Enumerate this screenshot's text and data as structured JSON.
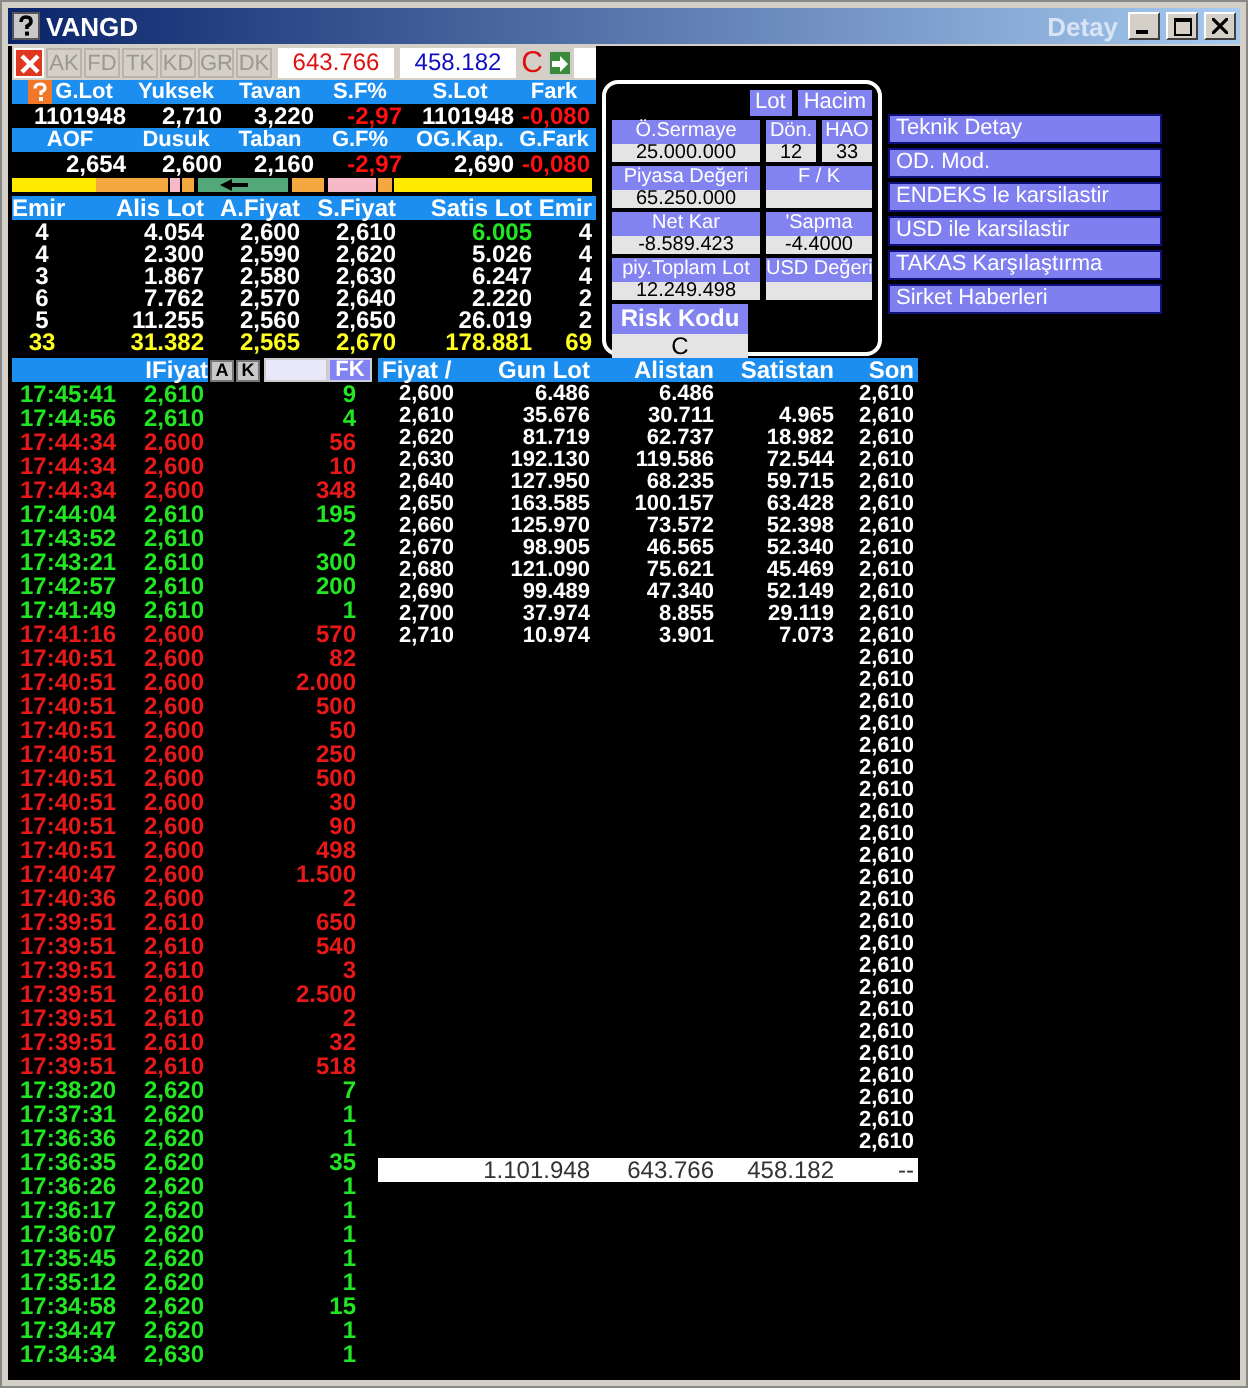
{
  "window": {
    "title": "VANGD",
    "right_title": "Detay"
  },
  "toolbar": {
    "tabs": [
      {
        "label": "AK",
        "disabled": true
      },
      {
        "label": "FD",
        "disabled": true
      },
      {
        "label": "TK",
        "disabled": true
      },
      {
        "label": "KD",
        "disabled": true
      },
      {
        "label": "GR",
        "disabled": true
      },
      {
        "label": "DK",
        "disabled": true
      }
    ],
    "buy_total": "643.766",
    "sell_total": "458.182",
    "risk": "C"
  },
  "quote": {
    "blocks": [
      {
        "headers": [
          "G.Lot",
          "Yuksek",
          "Tavan",
          "S.F%",
          "S.Lot",
          "Fark"
        ],
        "values": [
          {
            "text": "1101948",
            "kind": "plain"
          },
          {
            "text": "2,710",
            "kind": "plain"
          },
          {
            "text": "3,220",
            "kind": "plain"
          },
          {
            "text": "-2,97",
            "kind": "down"
          },
          {
            "text": "1101948",
            "kind": "plain"
          },
          {
            "text": "-0,080",
            "kind": "down"
          }
        ]
      },
      {
        "headers": [
          "AOF",
          "Dusuk",
          "Taban",
          "G.F%",
          "OG.Kap.",
          "G.Fark"
        ],
        "values": [
          {
            "text": "2,654",
            "kind": "plain"
          },
          {
            "text": "2,600",
            "kind": "plain"
          },
          {
            "text": "2,160",
            "kind": "plain"
          },
          {
            "text": "-2,97",
            "kind": "down"
          },
          {
            "text": "2,690",
            "kind": "plain"
          },
          {
            "text": "-0,080",
            "kind": "down"
          }
        ]
      }
    ]
  },
  "depth": {
    "headers": [
      "Emir",
      "Alis Lot",
      "A.Fiyat",
      "S.Fiyat",
      "Satis Lot",
      "Emir"
    ],
    "rows": [
      {
        "cells": [
          "4",
          "4.054",
          "2,600",
          "2,610",
          "6.005",
          "4"
        ],
        "kind": "order",
        "highlight": true
      },
      {
        "cells": [
          "4",
          "2.300",
          "2,590",
          "2,620",
          "5.026",
          "4"
        ],
        "kind": "order",
        "highlight": false
      },
      {
        "cells": [
          "3",
          "1.867",
          "2,580",
          "2,630",
          "6.247",
          "4"
        ],
        "kind": "order",
        "highlight": false
      },
      {
        "cells": [
          "6",
          "7.762",
          "2,570",
          "2,640",
          "2.220",
          "2"
        ],
        "kind": "order",
        "highlight": false
      },
      {
        "cells": [
          "5",
          "11.255",
          "2,560",
          "2,650",
          "26.019",
          "2"
        ],
        "kind": "order",
        "highlight": false
      },
      {
        "cells": [
          "33",
          "31.382",
          "2,565",
          "2,670",
          "178.881",
          "69"
        ],
        "kind": "total",
        "highlight": false
      }
    ]
  },
  "stats": {
    "buttons": [
      "Lot",
      "Hacim"
    ],
    "rows": [
      [
        {
          "label": "Ö.Sermaye",
          "value": "25.000.000"
        },
        {
          "label": "Dön.",
          "value": "12"
        },
        {
          "label": "HAO",
          "value": "33"
        }
      ],
      [
        {
          "label": "Piyasa Değeri",
          "value": "65.250.000"
        },
        {
          "label": "F / K"
        }
      ],
      [
        {
          "label": "Net Kar",
          "value": "-8.589.423"
        },
        {
          "label": "'Sapma",
          "value": "-4.4000"
        }
      ],
      [
        {
          "label": "piy.Toplam Lot",
          "value": "12.249.498"
        },
        {
          "label": "USD Değeri"
        }
      ]
    ],
    "risk": {
      "label": "Risk Kodu",
      "value": "C"
    }
  },
  "menu": [
    "Teknik Detay",
    "OD. Mod.",
    "ENDEKS le karsilastir",
    "USD ile karsilastir",
    "TAKAS Karşılaştırma",
    "Sirket Haberleri"
  ],
  "trades": {
    "header": "IFiyat",
    "buttons": [
      "A",
      "K"
    ],
    "filter_button": "FK",
    "rows": [
      {
        "time": "17:45:41",
        "price": "2,610",
        "lot": "9",
        "kind": "up"
      },
      {
        "time": "17:44:56",
        "price": "2,610",
        "lot": "4",
        "kind": "up"
      },
      {
        "time": "17:44:34",
        "price": "2,600",
        "lot": "56",
        "kind": "down"
      },
      {
        "time": "17:44:34",
        "price": "2,600",
        "lot": "10",
        "kind": "down"
      },
      {
        "time": "17:44:34",
        "price": "2,600",
        "lot": "348",
        "kind": "down"
      },
      {
        "time": "17:44:04",
        "price": "2,610",
        "lot": "195",
        "kind": "up"
      },
      {
        "time": "17:43:52",
        "price": "2,610",
        "lot": "2",
        "kind": "up"
      },
      {
        "time": "17:43:21",
        "price": "2,610",
        "lot": "300",
        "kind": "up"
      },
      {
        "time": "17:42:57",
        "price": "2,610",
        "lot": "200",
        "kind": "up"
      },
      {
        "time": "17:41:49",
        "price": "2,610",
        "lot": "1",
        "kind": "up"
      },
      {
        "time": "17:41:16",
        "price": "2,600",
        "lot": "570",
        "kind": "down"
      },
      {
        "time": "17:40:51",
        "price": "2,600",
        "lot": "82",
        "kind": "down"
      },
      {
        "time": "17:40:51",
        "price": "2,600",
        "lot": "2.000",
        "kind": "down"
      },
      {
        "time": "17:40:51",
        "price": "2,600",
        "lot": "500",
        "kind": "down"
      },
      {
        "time": "17:40:51",
        "price": "2,600",
        "lot": "50",
        "kind": "down"
      },
      {
        "time": "17:40:51",
        "price": "2,600",
        "lot": "250",
        "kind": "down"
      },
      {
        "time": "17:40:51",
        "price": "2,600",
        "lot": "500",
        "kind": "down"
      },
      {
        "time": "17:40:51",
        "price": "2,600",
        "lot": "30",
        "kind": "down"
      },
      {
        "time": "17:40:51",
        "price": "2,600",
        "lot": "90",
        "kind": "down"
      },
      {
        "time": "17:40:51",
        "price": "2,600",
        "lot": "498",
        "kind": "down"
      },
      {
        "time": "17:40:47",
        "price": "2,600",
        "lot": "1.500",
        "kind": "down"
      },
      {
        "time": "17:40:36",
        "price": "2,600",
        "lot": "2",
        "kind": "down"
      },
      {
        "time": "17:39:51",
        "price": "2,610",
        "lot": "650",
        "kind": "down"
      },
      {
        "time": "17:39:51",
        "price": "2,610",
        "lot": "540",
        "kind": "down"
      },
      {
        "time": "17:39:51",
        "price": "2,610",
        "lot": "3",
        "kind": "down"
      },
      {
        "time": "17:39:51",
        "price": "2,610",
        "lot": "2.500",
        "kind": "down"
      },
      {
        "time": "17:39:51",
        "price": "2,610",
        "lot": "2",
        "kind": "down"
      },
      {
        "time": "17:39:51",
        "price": "2,610",
        "lot": "32",
        "kind": "down"
      },
      {
        "time": "17:39:51",
        "price": "2,610",
        "lot": "518",
        "kind": "down"
      },
      {
        "time": "17:38:20",
        "price": "2,620",
        "lot": "7",
        "kind": "up"
      },
      {
        "time": "17:37:31",
        "price": "2,620",
        "lot": "1",
        "kind": "up"
      },
      {
        "time": "17:36:36",
        "price": "2,620",
        "lot": "1",
        "kind": "up"
      },
      {
        "time": "17:36:35",
        "price": "2,620",
        "lot": "35",
        "kind": "up"
      },
      {
        "time": "17:36:26",
        "price": "2,620",
        "lot": "1",
        "kind": "up"
      },
      {
        "time": "17:36:17",
        "price": "2,620",
        "lot": "1",
        "kind": "up"
      },
      {
        "time": "17:36:07",
        "price": "2,620",
        "lot": "1",
        "kind": "up"
      },
      {
        "time": "17:35:45",
        "price": "2,620",
        "lot": "1",
        "kind": "up"
      },
      {
        "time": "17:35:12",
        "price": "2,620",
        "lot": "1",
        "kind": "up"
      },
      {
        "time": "17:34:58",
        "price": "2,620",
        "lot": "15",
        "kind": "up"
      },
      {
        "time": "17:34:47",
        "price": "2,620",
        "lot": "1",
        "kind": "up"
      },
      {
        "time": "17:34:34",
        "price": "2,630",
        "lot": "1",
        "kind": "up"
      }
    ]
  },
  "book": {
    "headers": [
      "Fiyat /",
      "Gun Lot",
      "Alistan",
      "Satistan",
      "Son"
    ],
    "rows": [
      {
        "price": "2,600",
        "gun_lot": "6.486",
        "alistan": "6.486",
        "son": "2,610"
      },
      {
        "price": "2,610",
        "gun_lot": "35.676",
        "alistan": "30.711",
        "satistan": "4.965",
        "son": "2,610"
      },
      {
        "price": "2,620",
        "gun_lot": "81.719",
        "alistan": "62.737",
        "satistan": "18.982",
        "son": "2,610"
      },
      {
        "price": "2,630",
        "gun_lot": "192.130",
        "alistan": "119.586",
        "satistan": "72.544",
        "son": "2,610"
      },
      {
        "price": "2,640",
        "gun_lot": "127.950",
        "alistan": "68.235",
        "satistan": "59.715",
        "son": "2,610"
      },
      {
        "price": "2,650",
        "gun_lot": "163.585",
        "alistan": "100.157",
        "satistan": "63.428",
        "son": "2,610"
      },
      {
        "price": "2,660",
        "gun_lot": "125.970",
        "alistan": "73.572",
        "satistan": "52.398",
        "son": "2,610"
      },
      {
        "price": "2,670",
        "gun_lot": "98.905",
        "alistan": "46.565",
        "satistan": "52.340",
        "son": "2,610"
      },
      {
        "price": "2,680",
        "gun_lot": "121.090",
        "alistan": "75.621",
        "satistan": "45.469",
        "son": "2,610"
      },
      {
        "price": "2,690",
        "gun_lot": "99.489",
        "alistan": "47.340",
        "satistan": "52.149",
        "son": "2,610"
      },
      {
        "price": "2,700",
        "gun_lot": "37.974",
        "alistan": "8.855",
        "satistan": "29.119",
        "son": "2,610"
      },
      {
        "price": "2,710",
        "gun_lot": "10.974",
        "alistan": "3.901",
        "satistan": "7.073",
        "son": "2,610"
      },
      {
        "son": "2,610"
      },
      {
        "son": "2,610"
      },
      {
        "son": "2,610"
      },
      {
        "son": "2,610"
      },
      {
        "son": "2,610"
      },
      {
        "son": "2,610"
      },
      {
        "son": "2,610"
      },
      {
        "son": "2,610"
      },
      {
        "son": "2,610"
      },
      {
        "son": "2,610"
      },
      {
        "son": "2,610"
      },
      {
        "son": "2,610"
      },
      {
        "son": "2,610"
      },
      {
        "son": "2,610"
      },
      {
        "son": "2,610"
      },
      {
        "son": "2,610"
      },
      {
        "son": "2,610"
      },
      {
        "son": "2,610"
      },
      {
        "son": "2,610"
      },
      {
        "son": "2,610"
      },
      {
        "son": "2,610"
      },
      {
        "son": "2,610"
      },
      {
        "son": "2,610"
      }
    ],
    "total": {
      "gun_lot": "1.101.948",
      "alistan": "643.766",
      "satistan": "458.182",
      "son": "--"
    }
  }
}
